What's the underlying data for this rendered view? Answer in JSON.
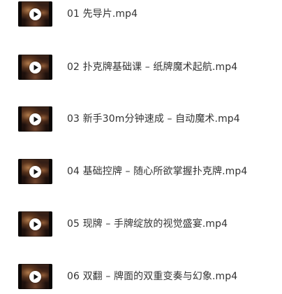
{
  "files": [
    {
      "name": "01 先导片.mp4",
      "icon": "video-play-icon"
    },
    {
      "name": "02 扑克牌基础课 – 纸牌魔术起航.mp4",
      "icon": "video-play-icon"
    },
    {
      "name": "03 新手30m分钟速成 – 自动魔术.mp4",
      "icon": "video-play-icon"
    },
    {
      "name": "04 基础控牌 – 随心所欲掌握扑克牌.mp4",
      "icon": "video-play-icon"
    },
    {
      "name": "05 现牌 – 手牌绽放的视觉盛宴.mp4",
      "icon": "video-play-icon"
    },
    {
      "name": "06 双翻 – 牌面的双重变奏与幻象.mp4",
      "icon": "video-play-icon"
    }
  ]
}
